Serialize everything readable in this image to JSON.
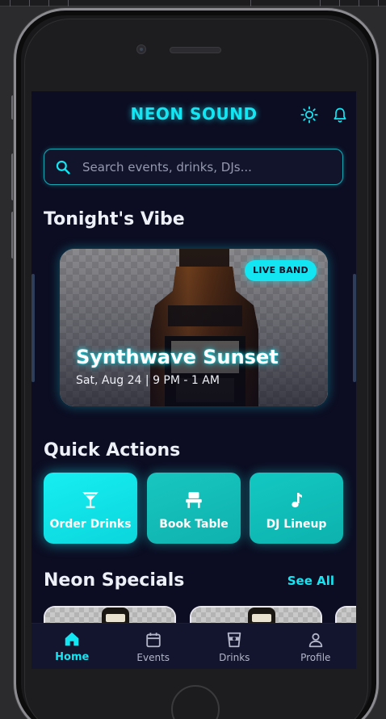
{
  "app": {
    "title": "NEON SOUND"
  },
  "search": {
    "placeholder": "Search events, drinks, DJs..."
  },
  "tonights_vibe": {
    "title": "Tonight's Vibe",
    "featured": {
      "badge": "LIVE BAND",
      "title": "Synthwave Sunset",
      "subtitle": "Sat, Aug 24 | 9 PM - 1 AM"
    }
  },
  "quick_actions": {
    "title": "Quick Actions",
    "items": [
      {
        "label": "Order Drinks",
        "icon": "cocktail-icon"
      },
      {
        "label": "Book Table",
        "icon": "chair-icon"
      },
      {
        "label": "DJ Lineup",
        "icon": "music-note-icon"
      }
    ]
  },
  "specials": {
    "title": "Neon Specials",
    "see_all": "See All"
  },
  "nav": {
    "items": [
      {
        "label": "Home",
        "icon": "home-icon",
        "active": true
      },
      {
        "label": "Events",
        "icon": "calendar-icon",
        "active": false
      },
      {
        "label": "Drinks",
        "icon": "drink-cup-icon",
        "active": false
      },
      {
        "label": "Profile",
        "icon": "person-icon",
        "active": false
      }
    ]
  },
  "colors": {
    "accent": "#13e6f2",
    "background": "#0c0d22",
    "nav_background": "#13142e"
  }
}
